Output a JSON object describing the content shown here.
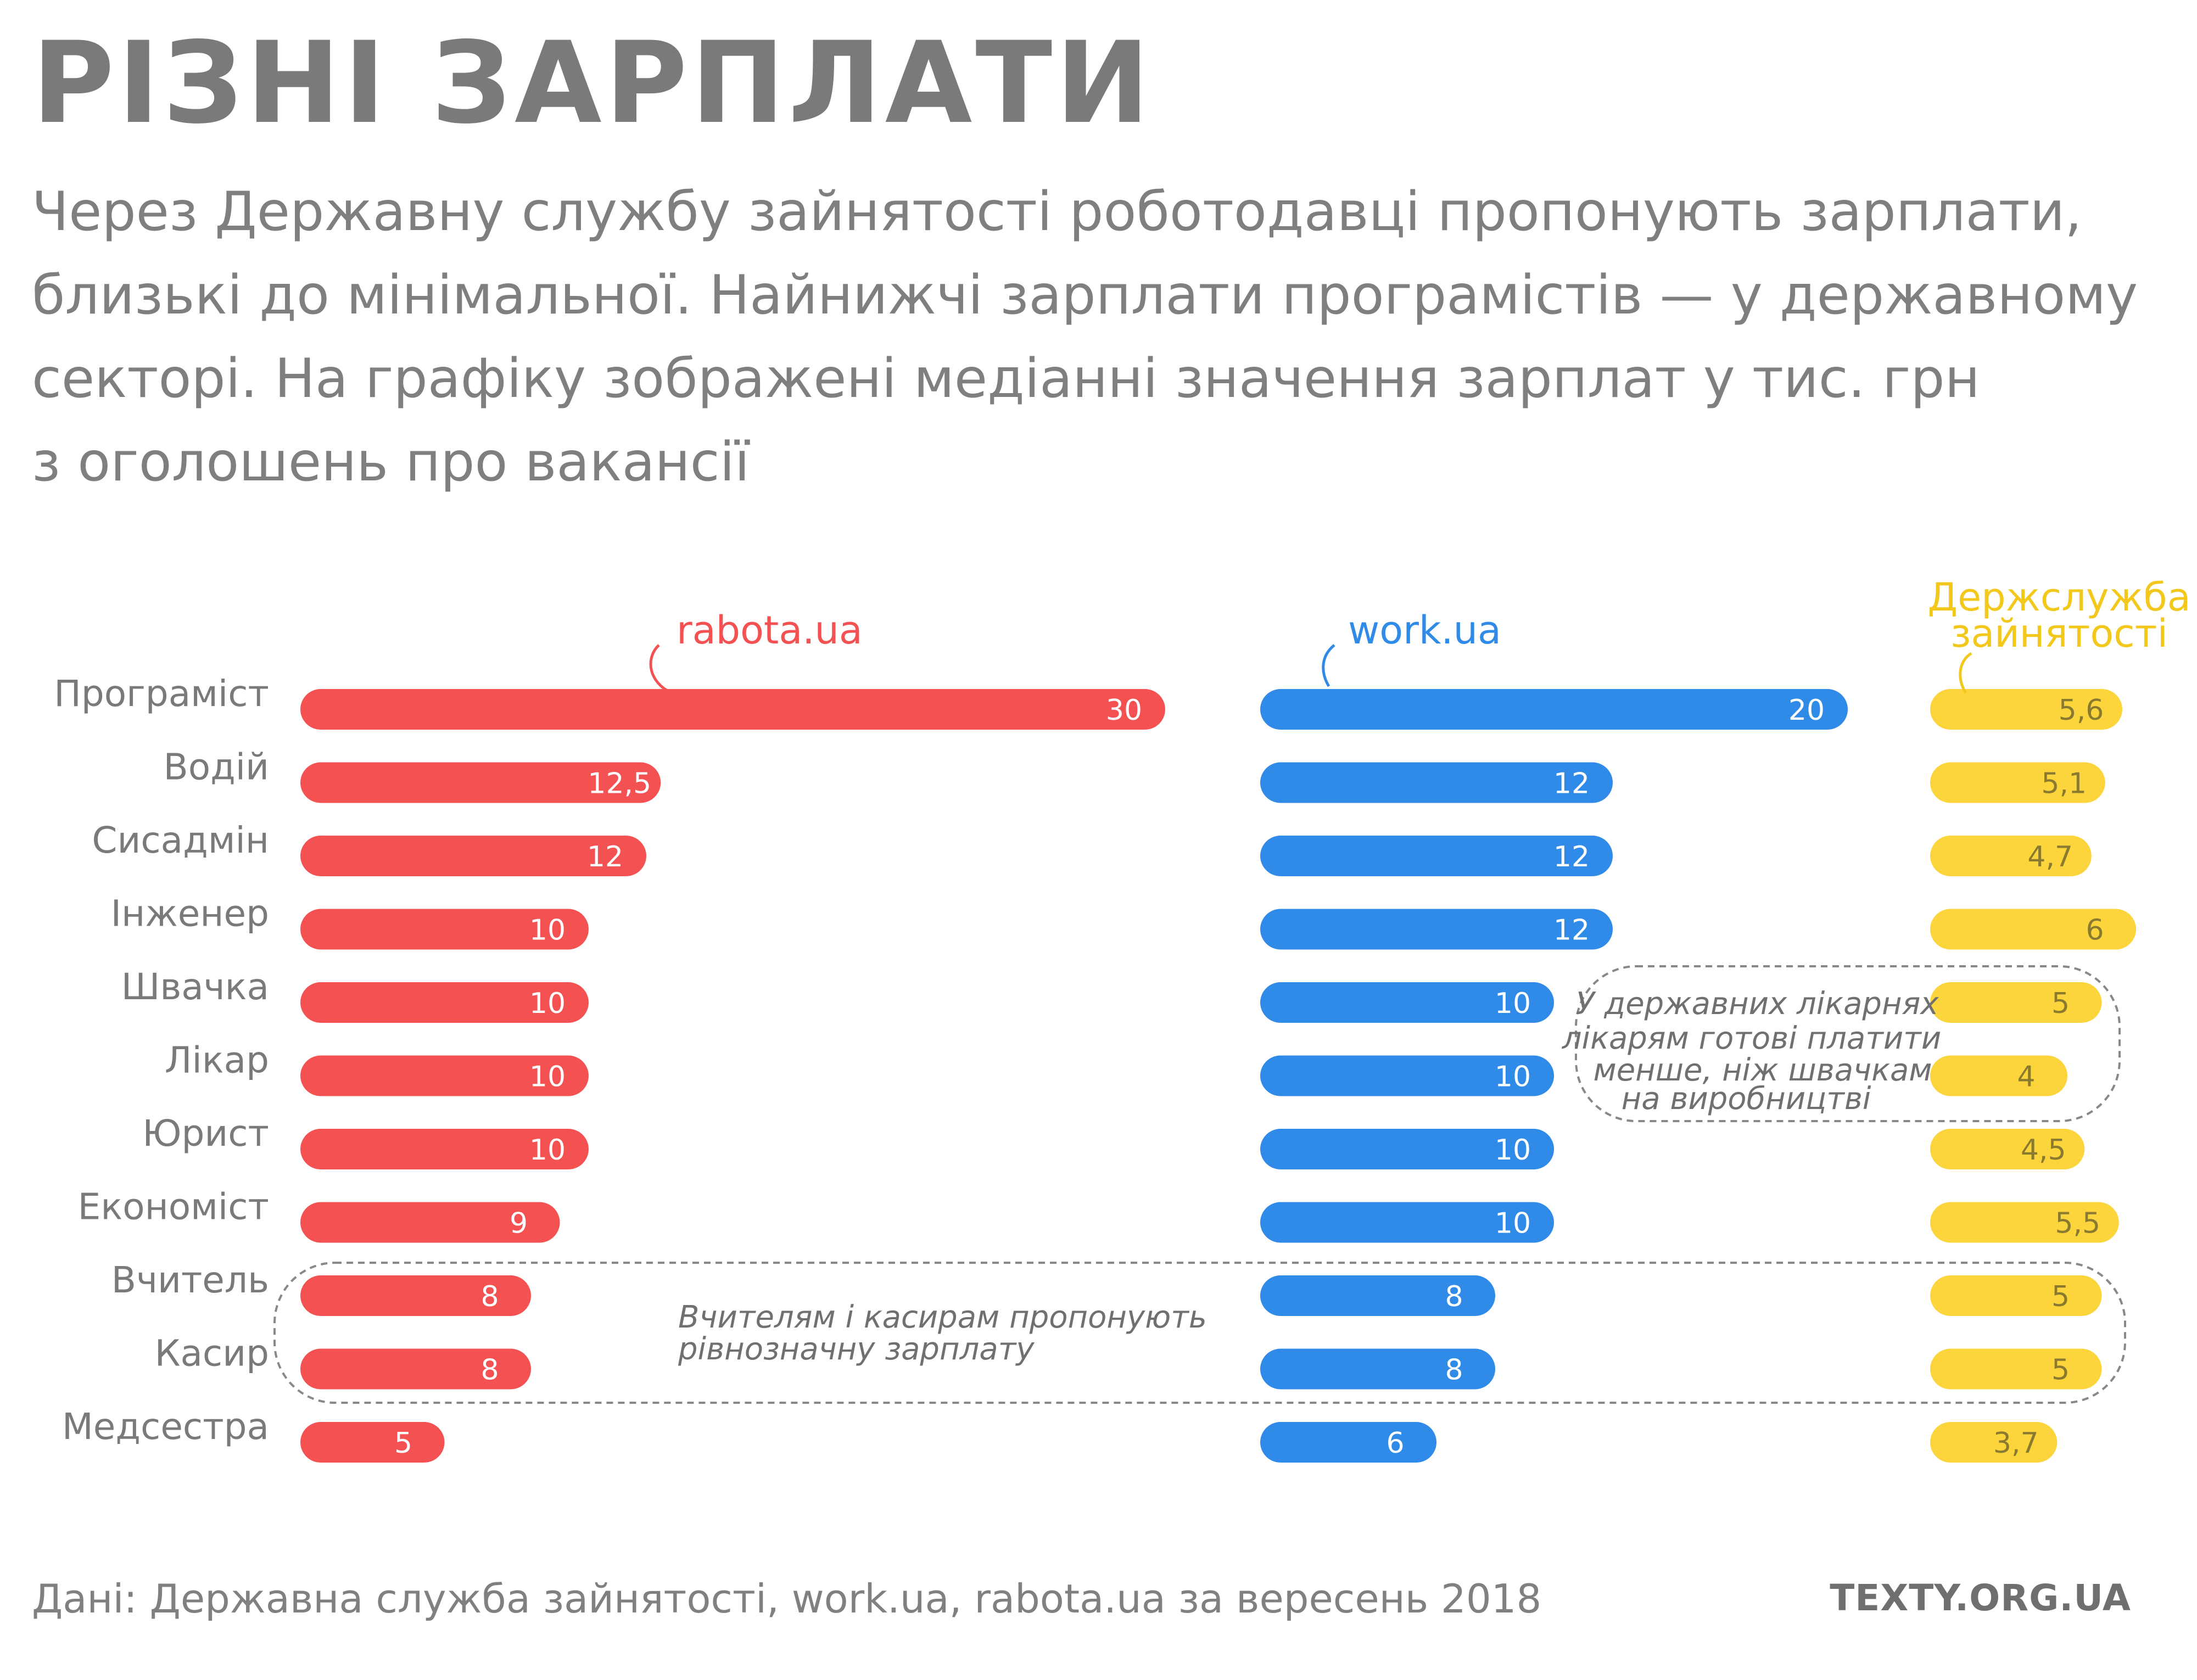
{
  "title": "РІЗНІ ЗАРПЛАТИ",
  "subtitle_lines": [
    "Через Державну службу зайнятості роботодавці пропонують зарплати,",
    "близькі до мінімальної. Найнижчі зарплати програмістів — у державному",
    "секторі. На графіку зображені медіанні значення зарплат у тис. грн",
    "з оголошень про вакансії"
  ],
  "source": "Дані: Державна служба зайнятості, work.ua, rabota.ua за вересень 2018",
  "brand": "TEXTY.ORG.UA",
  "colors": {
    "rabota": "#f45252",
    "work": "#2f8ae8",
    "dsz": "#fbd53b",
    "label": "#7a7a7a",
    "note": "#707070"
  },
  "chart_data": {
    "type": "bar",
    "orientation": "horizontal",
    "categories": [
      "Програміст",
      "Водій",
      "Сисадмін",
      "Інженер",
      "Швачка",
      "Лікар",
      "Юрист",
      "Економіст",
      "Вчитель",
      "Касир",
      "Медсестра"
    ],
    "series": [
      {
        "name": "rabota.ua",
        "values": [
          30,
          12.5,
          12,
          10,
          10,
          10,
          10,
          9,
          8,
          8,
          5
        ],
        "labels": [
          "30",
          "12,5",
          "12",
          "10",
          "10",
          "10",
          "10",
          "9",
          "8",
          "8",
          "5"
        ]
      },
      {
        "name": "work.ua",
        "values": [
          20,
          12,
          12,
          12,
          10,
          10,
          10,
          10,
          8,
          8,
          6
        ],
        "labels": [
          "20",
          "12",
          "12",
          "12",
          "10",
          "10",
          "10",
          "10",
          "8",
          "8",
          "6"
        ]
      },
      {
        "name": "Держслужба зайнятості",
        "name_lines": [
          "Держслужба",
          "зайнятості"
        ],
        "values": [
          5.6,
          5.1,
          4.7,
          6,
          5,
          4,
          4.5,
          5.5,
          5,
          5,
          3.7
        ],
        "labels": [
          "5,6",
          "5,1",
          "4,7",
          "6",
          "5",
          "4",
          "4,5",
          "5,5",
          "5",
          "5",
          "3,7"
        ]
      }
    ],
    "annotations": [
      {
        "lines": [
          "У державних лікарнях",
          "лікарям готові платити",
          "менше, ніж швачкам",
          "на виробництві"
        ],
        "categories": [
          "Швачка",
          "Лікар"
        ]
      },
      {
        "lines": [
          "Вчителям і касирам пропонують",
          "рівнозначну зарплату"
        ],
        "categories": [
          "Вчитель",
          "Касир"
        ]
      }
    ]
  }
}
